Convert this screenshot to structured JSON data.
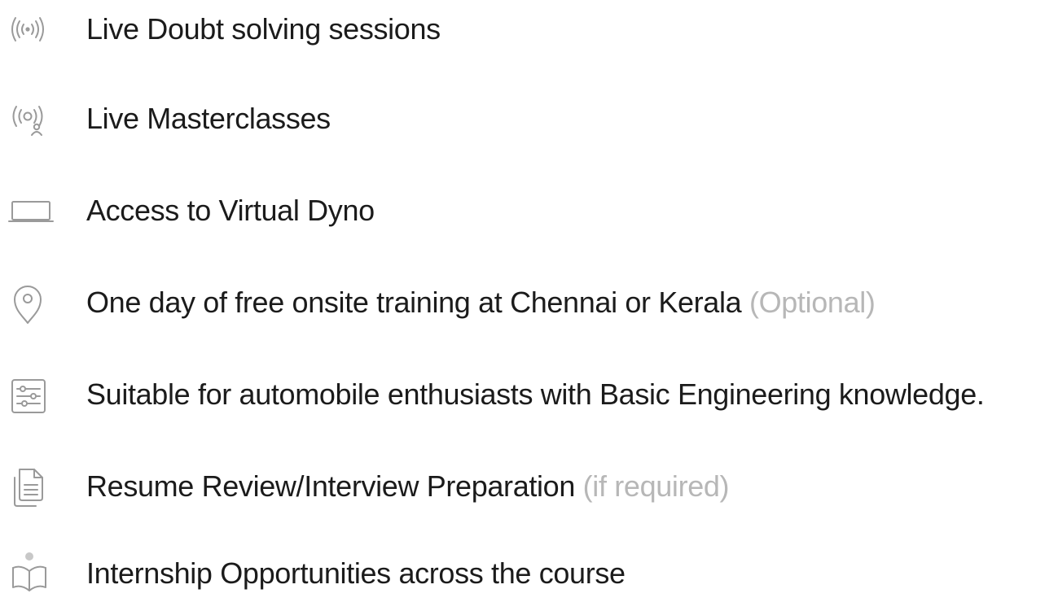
{
  "features": [
    {
      "icon": "live-broadcast-icon",
      "text": "Live Doubt solving sessions",
      "note": ""
    },
    {
      "icon": "live-masterclass-icon",
      "text": "Live Masterclasses",
      "note": ""
    },
    {
      "icon": "laptop-icon",
      "text": "Access to Virtual Dyno",
      "note": ""
    },
    {
      "icon": "location-pin-icon",
      "text": "One day of free onsite training at Chennai or Kerala",
      "note": "(Optional)"
    },
    {
      "icon": "sliders-icon",
      "text": "Suitable for automobile enthusiasts with Basic Engineering knowledge.",
      "note": ""
    },
    {
      "icon": "document-icon",
      "text": "Resume Review/Interview Preparation",
      "note": "(if required)"
    },
    {
      "icon": "open-book-person-icon",
      "text": "Internship Opportunities across the course",
      "note": ""
    }
  ],
  "colors": {
    "text": "#1b1b1b",
    "note": "#b7b7b7",
    "icon": "#9a9a9a",
    "background": "#ffffff"
  }
}
